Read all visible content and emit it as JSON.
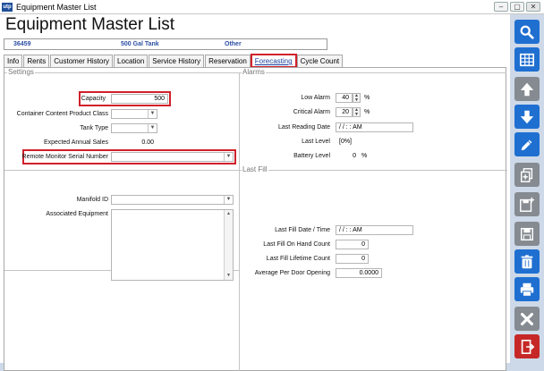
{
  "window": {
    "app_icon": "utp",
    "title": "Equipment Master List",
    "buttons": {
      "minimize": "–",
      "maximize": "▢",
      "close": "✕"
    }
  },
  "page_title": "Equipment Master List",
  "info_strip": {
    "id": "36459",
    "description": "500 Gal Tank",
    "type": "Other"
  },
  "tabs": [
    {
      "label": "Info"
    },
    {
      "label": "Rents"
    },
    {
      "label": "Customer History"
    },
    {
      "label": "Location"
    },
    {
      "label": "Service History"
    },
    {
      "label": "Reservation"
    },
    {
      "label": "Forecasting",
      "active": true
    },
    {
      "label": "Cycle Count"
    }
  ],
  "settings": {
    "group_label": "Settings",
    "capacity": {
      "label": "Capacity",
      "value": "500"
    },
    "container_content_product_class": {
      "label": "Container Content Product Class",
      "value": ""
    },
    "tank_type": {
      "label": "Tank Type",
      "value": ""
    },
    "expected_annual_sales": {
      "label": "Expected Annual Sales",
      "value": "0.00"
    },
    "remote_monitor_serial_number": {
      "label": "Remote Monitor Serial Number",
      "value": ""
    }
  },
  "alarms": {
    "group_label": "Alarms",
    "low_alarm": {
      "label": "Low Alarm",
      "value": "40",
      "unit": "%"
    },
    "critical_alarm": {
      "label": "Critical Alarm",
      "value": "20",
      "unit": "%"
    },
    "last_reading_date": {
      "label": "Last Reading Date",
      "value": "/ /    : :  AM"
    },
    "last_level": {
      "label": "Last Level",
      "value": "[0%]"
    },
    "battery_level": {
      "label": "Battery Level",
      "value": "0",
      "unit": "%"
    }
  },
  "manifold": {
    "manifold_id": {
      "label": "Manifold ID",
      "value": ""
    },
    "associated_equipment": {
      "label": "Associated Equipment"
    }
  },
  "last_fill": {
    "group_label": "Last Fill",
    "last_fill_date_time": {
      "label": "Last Fill Date / Time",
      "value": "/ /    : :  AM"
    },
    "last_fill_on_hand_count": {
      "label": "Last Fill On Hand Count",
      "value": "0"
    },
    "last_fill_lifetime_count": {
      "label": "Last Fill Lifetime Count",
      "value": "0"
    },
    "average_per_door_opening": {
      "label": "Average Per Door Opening",
      "value": "0.0000"
    }
  },
  "toolbar_icons": [
    "search-icon",
    "grid-icon",
    "arrow-up-icon",
    "arrow-down-icon",
    "pencil-icon",
    "copy-add-icon",
    "save-new-icon",
    "save-icon",
    "trash-icon",
    "print-icon",
    "cancel-icon",
    "exit-icon"
  ],
  "colors": {
    "accent": "#1f6fd1",
    "highlight": "#d0202a",
    "disabled": "#858b91",
    "exit": "#c62828"
  }
}
